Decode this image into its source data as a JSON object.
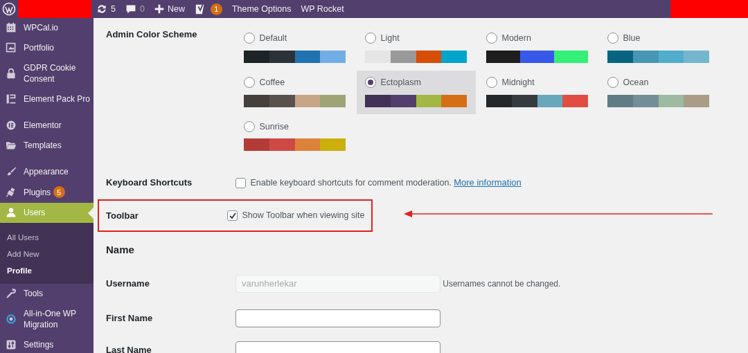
{
  "admin_bar": {
    "items": [
      {
        "kind": "updates",
        "text": "5"
      },
      {
        "kind": "comments",
        "text": "0"
      },
      {
        "kind": "new",
        "text": "New"
      },
      {
        "kind": "yoast",
        "badge": "1"
      },
      {
        "kind": "link",
        "text": "Theme Options"
      },
      {
        "kind": "link",
        "text": "WP Rocket"
      }
    ]
  },
  "sidebar": {
    "items": [
      {
        "label": "WPCal.io",
        "selected": false
      },
      {
        "label": "Portfolio",
        "selected": false
      },
      {
        "label": "GDPR Cookie Consent",
        "selected": false
      },
      {
        "label": "Element Pack Pro",
        "selected": false
      },
      {
        "label": "Elementor",
        "selected": false
      },
      {
        "label": "Templates",
        "selected": false
      },
      {
        "label": "Appearance",
        "selected": false
      },
      {
        "label": "Plugins",
        "selected": false,
        "badge": "5"
      },
      {
        "label": "Users",
        "selected": true,
        "children": [
          {
            "label": "All Users",
            "selected": false
          },
          {
            "label": "Add New",
            "selected": false
          },
          {
            "label": "Profile",
            "selected": true
          }
        ]
      },
      {
        "label": "Tools",
        "selected": false
      },
      {
        "label": "All-in-One WP Migration",
        "selected": false
      },
      {
        "label": "Settings",
        "selected": false
      }
    ]
  },
  "color_scheme": {
    "label": "Admin Color Scheme",
    "options": [
      {
        "name": "Default",
        "selected": false
      },
      {
        "name": "Light",
        "selected": false
      },
      {
        "name": "Modern",
        "selected": false
      },
      {
        "name": "Blue",
        "selected": false
      },
      {
        "name": "Coffee",
        "selected": false
      },
      {
        "name": "Ectoplasm",
        "selected": true
      },
      {
        "name": "Midnight",
        "selected": false
      },
      {
        "name": "Ocean",
        "selected": false
      },
      {
        "name": "Sunrise",
        "selected": false
      }
    ]
  },
  "keyboard_shortcuts": {
    "label": "Keyboard Shortcuts",
    "checkbox_label": "Enable keyboard shortcuts for comment moderation.",
    "checked": false,
    "link": "More information"
  },
  "toolbar": {
    "label": "Toolbar",
    "checkbox_label": "Show Toolbar when viewing site",
    "checked": true,
    "highlighted": true
  },
  "name_section": {
    "heading": "Name",
    "fields": [
      {
        "label": "Username",
        "value": "varunherlekar",
        "disabled": true,
        "note": "Usernames cannot be changed."
      },
      {
        "label": "First Name",
        "disabled": false
      },
      {
        "label": "Last Name",
        "disabled": false
      }
    ]
  }
}
